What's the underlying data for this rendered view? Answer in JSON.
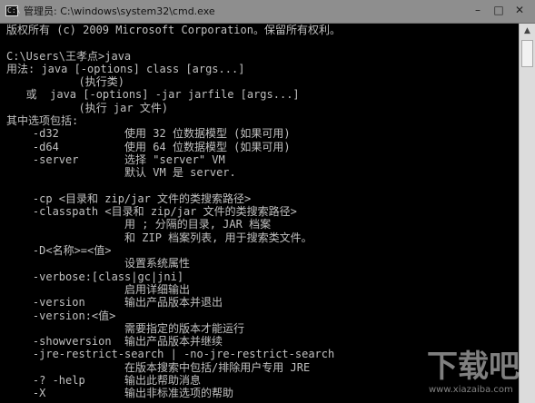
{
  "window": {
    "icon_text": "C:\\",
    "title": "管理员: C:\\windows\\system32\\cmd.exe",
    "minimize_glyph": "–",
    "maximize_glyph": "□",
    "close_glyph": "✕"
  },
  "console": {
    "lines": [
      "版权所有 (c) 2009 Microsoft Corporation。保留所有权利。",
      "",
      "C:\\Users\\王孝点>java",
      "用法: java [-options] class [args...]",
      "           (执行类)",
      "   或  java [-options] -jar jarfile [args...]",
      "           (执行 jar 文件)",
      "其中选项包括:",
      "    -d32          使用 32 位数据模型 (如果可用)",
      "    -d64          使用 64 位数据模型 (如果可用)",
      "    -server       选择 \"server\" VM",
      "                  默认 VM 是 server.",
      "",
      "    -cp <目录和 zip/jar 文件的类搜索路径>",
      "    -classpath <目录和 zip/jar 文件的类搜索路径>",
      "                  用 ; 分隔的目录, JAR 档案",
      "                  和 ZIP 档案列表, 用于搜索类文件。",
      "    -D<名称>=<值>",
      "                  设置系统属性",
      "    -verbose:[class|gc|jni]",
      "                  启用详细输出",
      "    -version      输出产品版本并退出",
      "    -version:<值>",
      "                  需要指定的版本才能运行",
      "    -showversion  输出产品版本并继续",
      "    -jre-restrict-search | -no-jre-restrict-search",
      "                  在版本搜索中包括/排除用户专用 JRE",
      "    -? -help      输出此帮助消息",
      "    -X            输出非标准选项的帮助"
    ]
  },
  "scrollbar": {
    "up_glyph": "▲"
  },
  "watermark": {
    "text": "下载吧",
    "url": "www.xiazaiba.com"
  },
  "colors": {
    "console_bg": "#000000",
    "console_text": "#c0c0c0",
    "titlebar": "#8e8e8e"
  }
}
